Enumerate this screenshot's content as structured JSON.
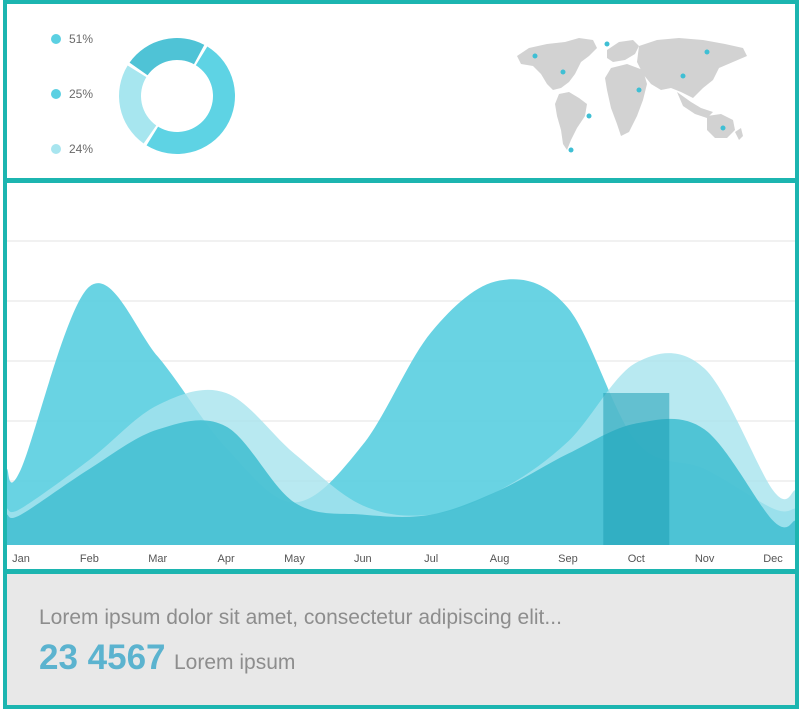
{
  "legend": [
    {
      "label": "51%",
      "color": "#5bd0e2"
    },
    {
      "label": "25%",
      "color": "#5bd0e2"
    },
    {
      "label": "24%",
      "color": "#a8e5ef"
    }
  ],
  "donut": {
    "slices": [
      {
        "value": 51,
        "color": "#5ed3e4"
      },
      {
        "value": 25,
        "color": "#a7e6ef"
      },
      {
        "value": 24,
        "color": "#4fc3d6"
      }
    ]
  },
  "map": {
    "land_color": "#d2d2d2",
    "marker_color": "#3fbfd4"
  },
  "chart_data": {
    "type": "area",
    "categories": [
      "Jan",
      "Feb",
      "Mar",
      "Apr",
      "May",
      "Jun",
      "Jul",
      "Aug",
      "Sep",
      "Oct",
      "Nov",
      "Dec"
    ],
    "series": [
      {
        "values": [
          25,
          85,
          62,
          32,
          14,
          33,
          70,
          87,
          78,
          34,
          25,
          12
        ],
        "color": "#5ccfe1"
      },
      {
        "values": [
          12,
          28,
          46,
          50,
          30,
          13,
          10,
          18,
          34,
          60,
          58,
          18
        ],
        "color": "#a6e4ee"
      },
      {
        "values": [
          10,
          25,
          38,
          39,
          14,
          10,
          10,
          18,
          30,
          40,
          38,
          8
        ],
        "color": "#46c0d2"
      }
    ],
    "highlight": {
      "category": "Oct",
      "color": "#1d9fb4"
    },
    "ylim": [
      0,
      100
    ],
    "grid": true
  },
  "footer": {
    "text": "Lorem ipsum dolor sit amet, consectetur adipiscing elit...",
    "number": "23 4567",
    "caption": "Lorem ipsum"
  }
}
